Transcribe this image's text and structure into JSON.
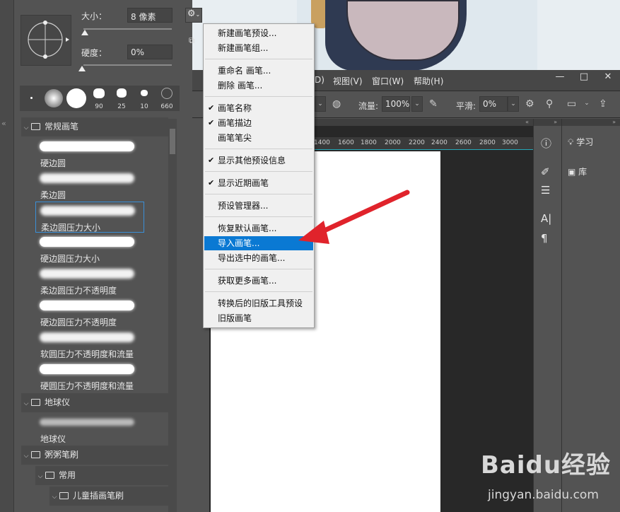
{
  "menubar": {
    "items": [
      "D)",
      "视图(V)",
      "窗口(W)",
      "帮助(H)"
    ],
    "win_controls": [
      "—",
      "□",
      "✕"
    ]
  },
  "options": {
    "flow_label": "流量:",
    "flow_value": "100%",
    "smooth_label": "平滑:",
    "smooth_value": "0%"
  },
  "ruler_ticks": [
    "1400",
    "1600",
    "1800",
    "2000",
    "2200",
    "2400",
    "2600",
    "2800",
    "3000"
  ],
  "right_panel": {
    "learn_label": "学习",
    "library_label": "库"
  },
  "brush_panel": {
    "size_label": "大小：",
    "size_value": "8 像素",
    "hardness_label": "硬度：",
    "hardness_value": "0%",
    "tips": [
      "",
      "",
      "",
      "90",
      "25",
      "10",
      "660"
    ],
    "groups": [
      {
        "name": "常规画笔",
        "items": [
          "硬边圆",
          "柔边圆",
          "柔边圆压力大小",
          "硬边圆压力大小",
          "柔边圆压力不透明度",
          "硬边圆压力不透明度",
          "软圆压力不透明度和流量",
          "硬圆压力不透明度和流量"
        ]
      },
      {
        "name": "地球仪",
        "items": [
          "地球仪"
        ]
      },
      {
        "name": "粥粥笔刷"
      },
      {
        "name": "常用"
      },
      {
        "name": "儿童插画笔刷"
      }
    ]
  },
  "context_menu": {
    "items": [
      {
        "label": "新建画笔预设...",
        "checked": false
      },
      {
        "label": "新建画笔组...",
        "checked": false
      },
      {
        "label": "重命名 画笔...",
        "checked": false
      },
      {
        "label": "删除 画笔...",
        "checked": false
      },
      {
        "label": "画笔名称",
        "checked": true
      },
      {
        "label": "画笔描边",
        "checked": true
      },
      {
        "label": "画笔笔尖",
        "checked": false
      },
      {
        "label": "显示其他预设信息",
        "checked": true
      },
      {
        "label": "显示近期画笔",
        "checked": true
      },
      {
        "label": "预设管理器...",
        "checked": false
      },
      {
        "label": "恢复默认画笔...",
        "checked": false
      },
      {
        "label": "导入画笔...",
        "checked": false,
        "highlighted": true
      },
      {
        "label": "导出选中的画笔...",
        "checked": false
      },
      {
        "label": "获取更多画笔...",
        "checked": false
      },
      {
        "label": "转换后的旧版工具预设",
        "checked": false
      },
      {
        "label": "旧版画笔",
        "checked": false
      }
    ]
  },
  "watermark": {
    "logo": "Baidu经验",
    "url": "jingyan.baidu.com"
  },
  "colors": {
    "highlight": "#0a79d3",
    "arrow": "#e0232b",
    "selection_border": "#3b8fd6"
  }
}
